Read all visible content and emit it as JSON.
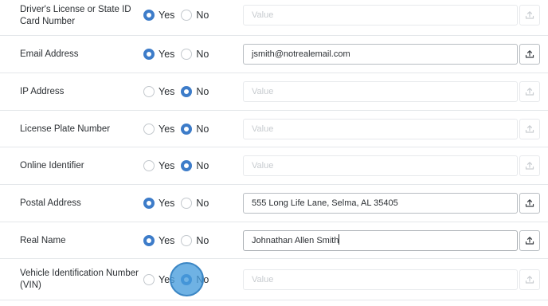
{
  "rows": [
    {
      "label": "Driver's License or State ID Card Number",
      "yes": "Yes",
      "no": "No",
      "selected": "yes",
      "value": "",
      "placeholder": "Value"
    },
    {
      "label": "Email Address",
      "yes": "Yes",
      "no": "No",
      "selected": "yes",
      "value": "jsmith@notrealemail.com",
      "placeholder": "Value"
    },
    {
      "label": "IP Address",
      "yes": "Yes",
      "no": "No",
      "selected": "no",
      "value": "",
      "placeholder": "Value"
    },
    {
      "label": "License Plate Number",
      "yes": "Yes",
      "no": "No",
      "selected": "no",
      "value": "",
      "placeholder": "Value"
    },
    {
      "label": "Online Identifier",
      "yes": "Yes",
      "no": "No",
      "selected": "no",
      "value": "",
      "placeholder": "Value"
    },
    {
      "label": "Postal Address",
      "yes": "Yes",
      "no": "No",
      "selected": "yes",
      "value": "555 Long Life Lane, Selma, AL 35405",
      "placeholder": "Value"
    },
    {
      "label": "Real Name",
      "yes": "Yes",
      "no": "No",
      "selected": "yes",
      "value": "Johnathan Allen Smith",
      "placeholder": "Value"
    },
    {
      "label": "Vehicle Identification Number (VIN)",
      "yes": "Yes",
      "no": "No",
      "selected": "no",
      "value": "",
      "placeholder": "Value"
    }
  ],
  "colors": {
    "accent": "#3d7cc9",
    "cursor_highlight": "#479cdc"
  },
  "icons": {
    "upload": "upload-icon"
  }
}
